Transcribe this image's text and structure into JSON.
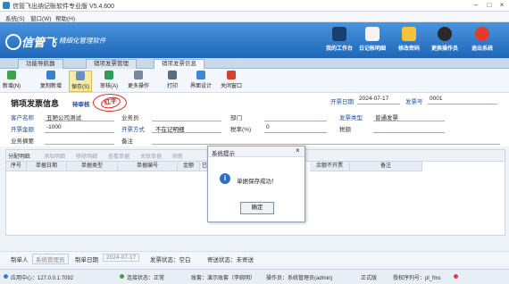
{
  "window": {
    "title": "信管飞出纳记账软件专业版 V5.4.600"
  },
  "menu": [
    "系统(S)",
    "窗口(W)",
    "帮助(H)"
  ],
  "brand": {
    "name": "信管飞",
    "sub": "精细化管理软件"
  },
  "top_tools": [
    {
      "label": "我的工作台",
      "icon": "desk-icon"
    },
    {
      "label": "日记帐明细",
      "icon": "ledger-icon"
    },
    {
      "label": "修改密码",
      "icon": "lock-icon"
    },
    {
      "label": "更换操作员",
      "icon": "user-icon"
    },
    {
      "label": "退出系统",
      "icon": "exit-icon"
    }
  ],
  "tabs": [
    "功能导航器",
    "销项发票管理",
    "销项发票信息"
  ],
  "toolbar": [
    {
      "label": "新增(N)",
      "icon": "add-icon"
    },
    {
      "label": "复制新增",
      "icon": "copy-icon"
    },
    {
      "label": "保存(S)",
      "icon": "save-icon"
    },
    {
      "label": "审核(A)",
      "icon": "approve-icon"
    },
    {
      "label": "更多操作",
      "icon": "more-icon"
    },
    {
      "label": "打印",
      "icon": "print-icon"
    },
    {
      "label": "界面设计",
      "icon": "design-icon"
    },
    {
      "label": "关闭窗口",
      "icon": "close-window-icon"
    }
  ],
  "form": {
    "title": "销项发票信息",
    "status": "待审核",
    "stamp": "红字",
    "invoice_date_label": "开票日期",
    "invoice_date": "2024-07-17",
    "invoice_no_label": "发票号",
    "invoice_no": "0001",
    "customer_label": "客户名称",
    "customer": "丑陋公司测试",
    "salesman_label": "业务员",
    "dept_label": "部门",
    "invoice_type_label": "发票类型",
    "invoice_type": "普通发票",
    "amount_label": "开票金额",
    "amount": "-1000",
    "method_label": "开票方式",
    "method": "不在记明细",
    "tax_rate_label": "税率(%)",
    "tax_rate": "0",
    "tax_label": "税额",
    "summary_label": "业务摘要",
    "remark_label": "备注"
  },
  "detail_bar": {
    "label": "分配明细:",
    "items": [
      "添加明细",
      "移除明细",
      "查看单据",
      "关联单据",
      "刷新"
    ]
  },
  "grid_headers": [
    "序号",
    "单据日期",
    "单据类型",
    "单据编号",
    "金额",
    "已开",
    "余额不开票",
    "备注"
  ],
  "footer": {
    "maker_label": "制单人",
    "maker": "系统管理员",
    "make_date_label": "制单日期",
    "make_date": "2024-07-17",
    "invoice_status": "发票状态：空白",
    "send_status": "寄送状态：未寄送"
  },
  "statusbar": {
    "server": "应用中心：127.0.0.1:7092",
    "conn": "连接状态：正常",
    "account": "账套：演示账套（李婉明）",
    "operator": "操作员：系统管理员(admin)",
    "version": "正式版",
    "license": "授权序列号：pl_fms"
  },
  "dialog": {
    "title": "系统提示",
    "message": "单据保存成功！",
    "ok": "确定"
  },
  "colors": {
    "banner": "#2b77c9",
    "accent": "#e02b2b",
    "link": "#1f4f9a"
  }
}
